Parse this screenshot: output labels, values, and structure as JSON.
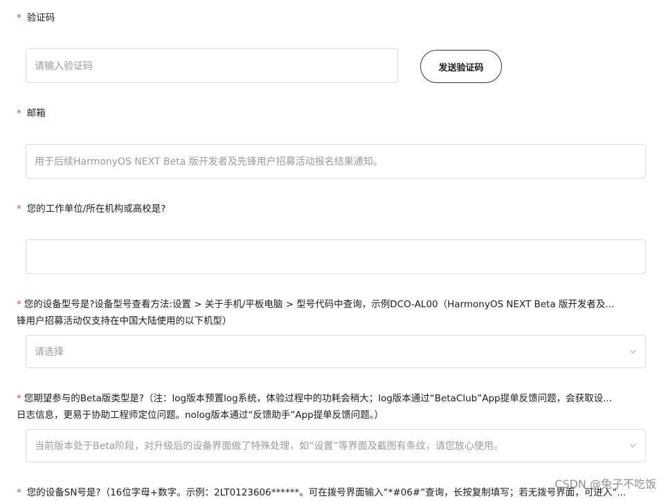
{
  "form": {
    "required_mark": "*",
    "verify_code": {
      "label": "验证码",
      "placeholder": "请输入验证码",
      "send_button": "发送验证码"
    },
    "email": {
      "label": "邮箱",
      "placeholder": "用于后续HarmonyOS NEXT Beta 版开发者及先锋用户招募活动报名结果通知。"
    },
    "organization": {
      "label": "您的工作单位/所在机构或高校是?",
      "value": ""
    },
    "device_model": {
      "label_line1": "您的设备型号是?设备型号查看方法:设置 > 关于手机/平板电脑 > 型号代码中查询，示例DCO-AL00（HarmonyOS NEXT Beta 版开发者及...",
      "label_line2": "锋用户招募活动仅支持在中国大陆使用的以下机型）",
      "placeholder": "请选择"
    },
    "beta_type": {
      "label_line1": "您期望参与的Beta版类型是?（注：log版本预置log系统，体验过程中的功耗会稍大；log版本通过“BetaClub”App提单反馈问题，会获取设...",
      "label_line2": "日志信息，更易于协助工程师定位问题。nolog版本通过“反馈助手”App提单反馈问题。）",
      "placeholder": "当前版本处于Beta阶段，对升级后的设备界面做了特殊处理，如“设置”等界面及截图有条纹，请您放心使用。"
    },
    "device_sn": {
      "label": "您的设备SN号是?（16位字母+数字。示例：2LT0123606******。可在拨号界面输入“*#06#”查询，长按复制填写；若无拨号界面，可进入“..."
    }
  },
  "watermark": "CSDN @兔子不吃饭",
  "icons": {
    "select_chevron": "chevron-down-icon"
  }
}
